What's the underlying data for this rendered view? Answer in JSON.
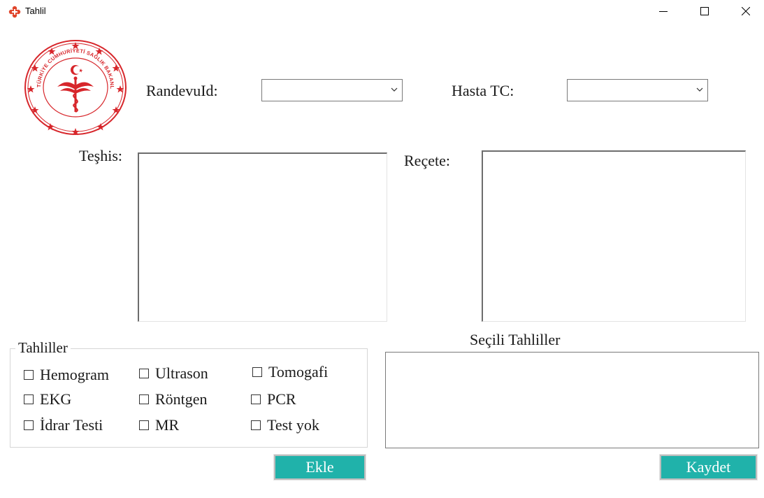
{
  "window": {
    "title": "Tahlil",
    "icons": {
      "app": "red-cross-icon",
      "minimize": "minimize-icon",
      "maximize": "maximize-icon",
      "close": "close-icon"
    }
  },
  "logo": {
    "name": "ministry-of-health-seal",
    "text": "TÜRKİYE CUMHURİYETİ SAĞLIK BAKANLIĞI",
    "color": "#d7262b"
  },
  "form": {
    "randevu_label": "RandevuId:",
    "randevu_value": "",
    "hasta_label": "Hasta TC:",
    "hasta_value": "",
    "teshis_label": "Teşhis:",
    "teshis_value": "",
    "recete_label": "Reçete:",
    "recete_value": ""
  },
  "tahliller": {
    "title": "Tahliller",
    "items": [
      {
        "label": "Hemogram",
        "checked": false
      },
      {
        "label": "Ultrason",
        "checked": false
      },
      {
        "label": "Tomogafi",
        "checked": false
      },
      {
        "label": "EKG",
        "checked": false
      },
      {
        "label": "Röntgen",
        "checked": false
      },
      {
        "label": "PCR",
        "checked": false
      },
      {
        "label": "İdrar Testi",
        "checked": false
      },
      {
        "label": "MR",
        "checked": false
      },
      {
        "label": "Test yok",
        "checked": false
      }
    ]
  },
  "selected": {
    "title": "Seçili Tahliller",
    "items": []
  },
  "buttons": {
    "ekle": "Ekle",
    "kaydet": "Kaydet"
  },
  "colors": {
    "button_bg": "#20b2aa",
    "button_text": "#ffffff",
    "logo_red": "#d7262b"
  }
}
